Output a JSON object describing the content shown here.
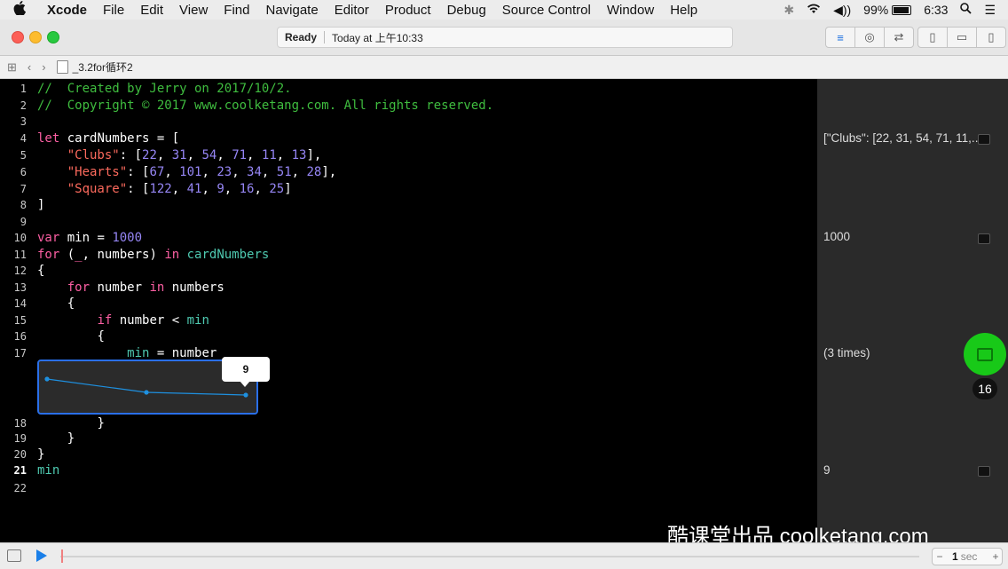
{
  "menubar": {
    "app": "Xcode",
    "items": [
      "File",
      "Edit",
      "View",
      "Find",
      "Navigate",
      "Editor",
      "Product",
      "Debug",
      "Source Control",
      "Window",
      "Help"
    ],
    "battery": "99%",
    "time": "6:33"
  },
  "toolbar": {
    "status_ready": "Ready",
    "status_time": "Today at 上午10:33"
  },
  "jumpbar": {
    "file_name": "_3.2for循环2"
  },
  "results": {
    "line4": "[\"Clubs\": [22, 31, 54, 71, 11,...",
    "line10": "1000",
    "line17": "(3 times)",
    "line21": "9"
  },
  "graph": {
    "tooltip": "9"
  },
  "badge": "16",
  "bottom": {
    "duration_value": "1",
    "duration_unit": "sec"
  },
  "watermark": "酷课堂出品 coolketang.com",
  "line_numbers": [
    "1",
    "2",
    "3",
    "4",
    "5",
    "6",
    "7",
    "8",
    "9",
    "10",
    "11",
    "12",
    "13",
    "14",
    "15",
    "16",
    "17",
    "18",
    "19",
    "20",
    "21",
    "22"
  ],
  "code": {
    "l1": "//  Created by Jerry on 2017/10/2.",
    "l2": "//  Copyright © 2017 www.coolketang.com. All rights reserved.",
    "l4_kw": "let",
    "l4_rest": " cardNumbers = [",
    "l5_key": "\"Clubs\"",
    "l5_pre": ": [",
    "l5_nums": [
      "22",
      "31",
      "54",
      "71",
      "11",
      "13"
    ],
    "l6_key": "\"Hearts\"",
    "l6_nums": [
      "67",
      "101",
      "23",
      "34",
      "51",
      "28"
    ],
    "l7_key": "\"Square\"",
    "l7_nums": [
      "122",
      "41",
      "9",
      "16",
      "25"
    ],
    "l8": "]",
    "l10_kw": "var",
    "l10_rest": " min = ",
    "l10_num": "1000",
    "l11_kw": "for",
    "l11_a": " (",
    "l11_us": "_",
    "l11_b": ", numbers) ",
    "l11_in": "in",
    "l11_c": " ",
    "l11_ref": "cardNumbers",
    "l12": "{",
    "l13_kw": "for",
    "l13_a": " number ",
    "l13_in": "in",
    "l13_b": " numbers",
    "l14": "{",
    "l15_kw": "if",
    "l15_a": " number < ",
    "l15_ref": "min",
    "l16": "{",
    "l17_ref": "min",
    "l17_a": " = number",
    "l18": "}",
    "l19": "}",
    "l20": "}",
    "l21": "min"
  },
  "colors": {
    "accent": "#2a6fe8",
    "green_button": "#18c918"
  }
}
